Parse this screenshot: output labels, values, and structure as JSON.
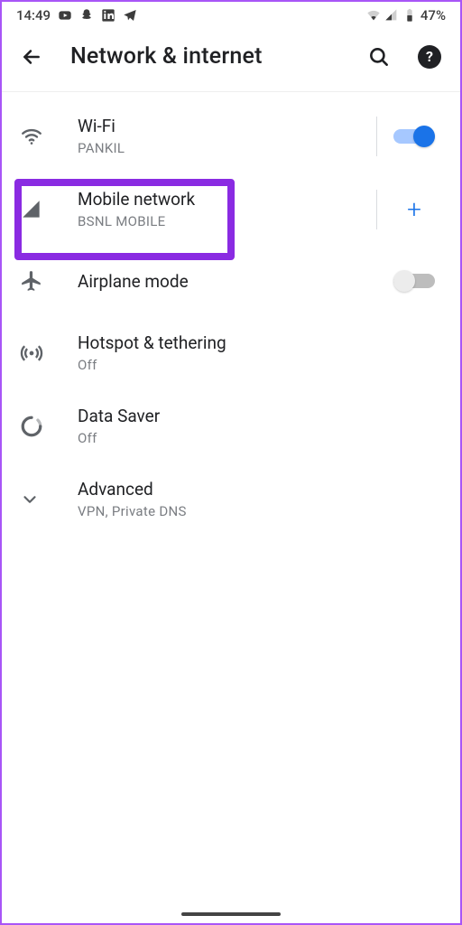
{
  "status": {
    "time": "14:49",
    "battery_pct": "47%"
  },
  "header": {
    "title": "Network & internet"
  },
  "items": {
    "wifi": {
      "label": "Wi-Fi",
      "sub": "PANKIL"
    },
    "mobile": {
      "label": "Mobile network",
      "sub": "BSNL MOBILE"
    },
    "airplane": {
      "label": "Airplane mode"
    },
    "hotspot": {
      "label": "Hotspot & tethering",
      "sub": "Off"
    },
    "datasaver": {
      "label": "Data Saver",
      "sub": "Off"
    },
    "advanced": {
      "label": "Advanced",
      "sub": "VPN, Private DNS"
    }
  }
}
